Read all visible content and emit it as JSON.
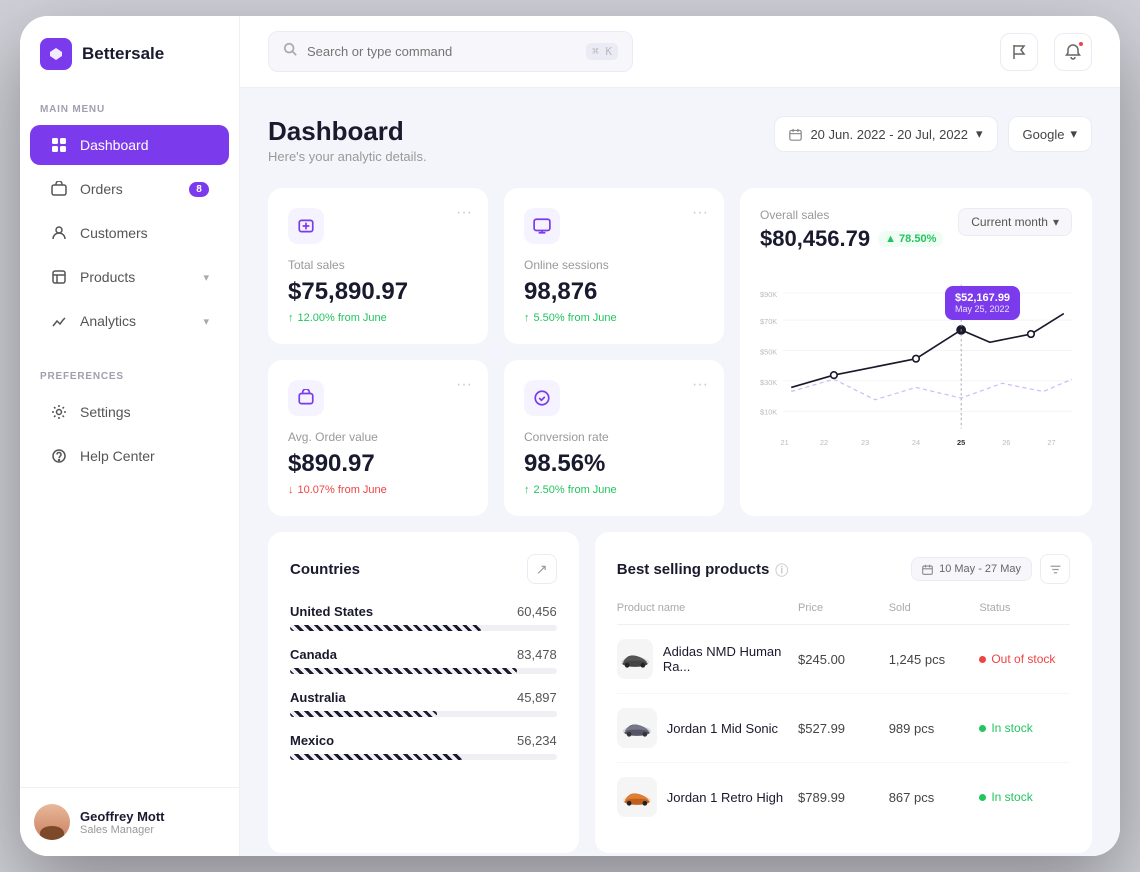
{
  "app": {
    "name": "Bettersale"
  },
  "topbar": {
    "search_placeholder": "Search or type command",
    "search_kbd": "⌘ K"
  },
  "sidebar": {
    "main_menu_label": "MAIN MENU",
    "preferences_label": "PREFERENCES",
    "items": [
      {
        "id": "dashboard",
        "label": "Dashboard",
        "active": true,
        "badge": null
      },
      {
        "id": "orders",
        "label": "Orders",
        "active": false,
        "badge": "8"
      },
      {
        "id": "customers",
        "label": "Customers",
        "active": false,
        "badge": null
      },
      {
        "id": "products",
        "label": "Products",
        "active": false,
        "badge": null,
        "chevron": true
      },
      {
        "id": "analytics",
        "label": "Analytics",
        "active": false,
        "badge": null,
        "chevron": true
      }
    ],
    "pref_items": [
      {
        "id": "settings",
        "label": "Settings"
      },
      {
        "id": "help",
        "label": "Help Center"
      }
    ],
    "user": {
      "name": "Geoffrey Mott",
      "role": "Sales Manager"
    }
  },
  "page": {
    "title": "Dashboard",
    "subtitle": "Here's your analytic details.",
    "date_range": "20 Jun. 2022 - 20 Jul, 2022",
    "source": "Google"
  },
  "stats": [
    {
      "id": "total-sales",
      "label": "Total sales",
      "value": "$75,890.97",
      "change": "12.00% from June",
      "change_dir": "up"
    },
    {
      "id": "online-sessions",
      "label": "Online sessions",
      "value": "98,876",
      "change": "5.50% from June",
      "change_dir": "up"
    },
    {
      "id": "avg-order",
      "label": "Avg. Order value",
      "value": "$890.97",
      "change": "10.07% from June",
      "change_dir": "down"
    },
    {
      "id": "conversion",
      "label": "Conversion rate",
      "value": "98.56%",
      "change": "2.50% from June",
      "change_dir": "up"
    }
  ],
  "overall_sales": {
    "label": "Overall sales",
    "value": "$80,456.79",
    "badge": "▲ 78.50%",
    "period_btn": "Current month",
    "tooltip_value": "$52,167.99",
    "tooltip_date": "May 25, 2022",
    "y_labels": [
      "$90K",
      "$70K",
      "$50K",
      "$30K",
      "$10K"
    ],
    "x_labels": [
      "21",
      "22",
      "23",
      "24",
      "25",
      "26",
      "27"
    ]
  },
  "countries": {
    "title": "Countries",
    "items": [
      {
        "name": "United States",
        "value": "60,456",
        "pct": 72
      },
      {
        "name": "Canada",
        "value": "83,478",
        "pct": 85
      },
      {
        "name": "Australia",
        "value": "45,897",
        "pct": 55
      },
      {
        "name": "Mexico",
        "value": "56,234",
        "pct": 65
      }
    ]
  },
  "best_selling": {
    "title": "Best selling products",
    "date_range": "10 May - 27 May",
    "columns": [
      "Product name",
      "Price",
      "Sold",
      "Status"
    ],
    "products": [
      {
        "name": "Adidas NMD Human Ra...",
        "price": "$245.00",
        "sold": "1,245 pcs",
        "status": "Out of stock",
        "status_type": "out"
      },
      {
        "name": "Jordan 1 Mid Sonic",
        "price": "$527.99",
        "sold": "989 pcs",
        "status": "In stock",
        "status_type": "in"
      },
      {
        "name": "Jordan 1 Retro High",
        "price": "$789.99",
        "sold": "867 pcs",
        "status": "In stock",
        "status_type": "in"
      }
    ]
  }
}
